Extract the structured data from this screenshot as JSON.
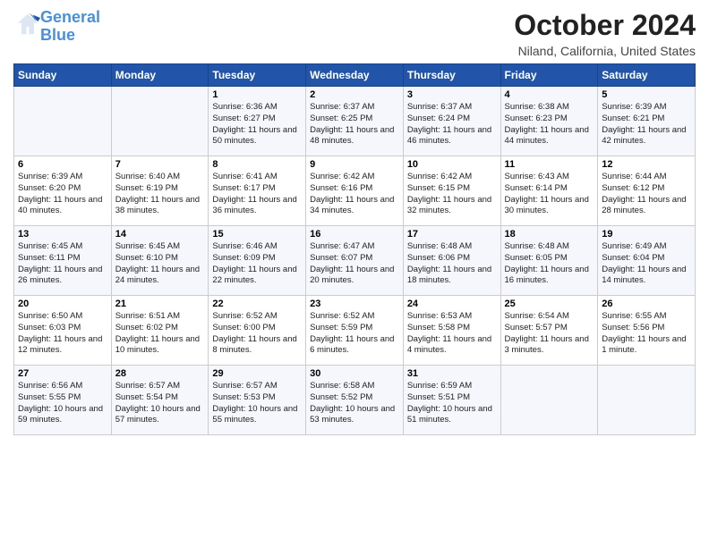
{
  "header": {
    "logo_line1": "General",
    "logo_line2": "Blue",
    "month": "October 2024",
    "location": "Niland, California, United States"
  },
  "weekdays": [
    "Sunday",
    "Monday",
    "Tuesday",
    "Wednesday",
    "Thursday",
    "Friday",
    "Saturday"
  ],
  "weeks": [
    [
      {
        "day": "",
        "info": ""
      },
      {
        "day": "",
        "info": ""
      },
      {
        "day": "1",
        "info": "Sunrise: 6:36 AM\nSunset: 6:27 PM\nDaylight: 11 hours and 50 minutes."
      },
      {
        "day": "2",
        "info": "Sunrise: 6:37 AM\nSunset: 6:25 PM\nDaylight: 11 hours and 48 minutes."
      },
      {
        "day": "3",
        "info": "Sunrise: 6:37 AM\nSunset: 6:24 PM\nDaylight: 11 hours and 46 minutes."
      },
      {
        "day": "4",
        "info": "Sunrise: 6:38 AM\nSunset: 6:23 PM\nDaylight: 11 hours and 44 minutes."
      },
      {
        "day": "5",
        "info": "Sunrise: 6:39 AM\nSunset: 6:21 PM\nDaylight: 11 hours and 42 minutes."
      }
    ],
    [
      {
        "day": "6",
        "info": "Sunrise: 6:39 AM\nSunset: 6:20 PM\nDaylight: 11 hours and 40 minutes."
      },
      {
        "day": "7",
        "info": "Sunrise: 6:40 AM\nSunset: 6:19 PM\nDaylight: 11 hours and 38 minutes."
      },
      {
        "day": "8",
        "info": "Sunrise: 6:41 AM\nSunset: 6:17 PM\nDaylight: 11 hours and 36 minutes."
      },
      {
        "day": "9",
        "info": "Sunrise: 6:42 AM\nSunset: 6:16 PM\nDaylight: 11 hours and 34 minutes."
      },
      {
        "day": "10",
        "info": "Sunrise: 6:42 AM\nSunset: 6:15 PM\nDaylight: 11 hours and 32 minutes."
      },
      {
        "day": "11",
        "info": "Sunrise: 6:43 AM\nSunset: 6:14 PM\nDaylight: 11 hours and 30 minutes."
      },
      {
        "day": "12",
        "info": "Sunrise: 6:44 AM\nSunset: 6:12 PM\nDaylight: 11 hours and 28 minutes."
      }
    ],
    [
      {
        "day": "13",
        "info": "Sunrise: 6:45 AM\nSunset: 6:11 PM\nDaylight: 11 hours and 26 minutes."
      },
      {
        "day": "14",
        "info": "Sunrise: 6:45 AM\nSunset: 6:10 PM\nDaylight: 11 hours and 24 minutes."
      },
      {
        "day": "15",
        "info": "Sunrise: 6:46 AM\nSunset: 6:09 PM\nDaylight: 11 hours and 22 minutes."
      },
      {
        "day": "16",
        "info": "Sunrise: 6:47 AM\nSunset: 6:07 PM\nDaylight: 11 hours and 20 minutes."
      },
      {
        "day": "17",
        "info": "Sunrise: 6:48 AM\nSunset: 6:06 PM\nDaylight: 11 hours and 18 minutes."
      },
      {
        "day": "18",
        "info": "Sunrise: 6:48 AM\nSunset: 6:05 PM\nDaylight: 11 hours and 16 minutes."
      },
      {
        "day": "19",
        "info": "Sunrise: 6:49 AM\nSunset: 6:04 PM\nDaylight: 11 hours and 14 minutes."
      }
    ],
    [
      {
        "day": "20",
        "info": "Sunrise: 6:50 AM\nSunset: 6:03 PM\nDaylight: 11 hours and 12 minutes."
      },
      {
        "day": "21",
        "info": "Sunrise: 6:51 AM\nSunset: 6:02 PM\nDaylight: 11 hours and 10 minutes."
      },
      {
        "day": "22",
        "info": "Sunrise: 6:52 AM\nSunset: 6:00 PM\nDaylight: 11 hours and 8 minutes."
      },
      {
        "day": "23",
        "info": "Sunrise: 6:52 AM\nSunset: 5:59 PM\nDaylight: 11 hours and 6 minutes."
      },
      {
        "day": "24",
        "info": "Sunrise: 6:53 AM\nSunset: 5:58 PM\nDaylight: 11 hours and 4 minutes."
      },
      {
        "day": "25",
        "info": "Sunrise: 6:54 AM\nSunset: 5:57 PM\nDaylight: 11 hours and 3 minutes."
      },
      {
        "day": "26",
        "info": "Sunrise: 6:55 AM\nSunset: 5:56 PM\nDaylight: 11 hours and 1 minute."
      }
    ],
    [
      {
        "day": "27",
        "info": "Sunrise: 6:56 AM\nSunset: 5:55 PM\nDaylight: 10 hours and 59 minutes."
      },
      {
        "day": "28",
        "info": "Sunrise: 6:57 AM\nSunset: 5:54 PM\nDaylight: 10 hours and 57 minutes."
      },
      {
        "day": "29",
        "info": "Sunrise: 6:57 AM\nSunset: 5:53 PM\nDaylight: 10 hours and 55 minutes."
      },
      {
        "day": "30",
        "info": "Sunrise: 6:58 AM\nSunset: 5:52 PM\nDaylight: 10 hours and 53 minutes."
      },
      {
        "day": "31",
        "info": "Sunrise: 6:59 AM\nSunset: 5:51 PM\nDaylight: 10 hours and 51 minutes."
      },
      {
        "day": "",
        "info": ""
      },
      {
        "day": "",
        "info": ""
      }
    ]
  ]
}
